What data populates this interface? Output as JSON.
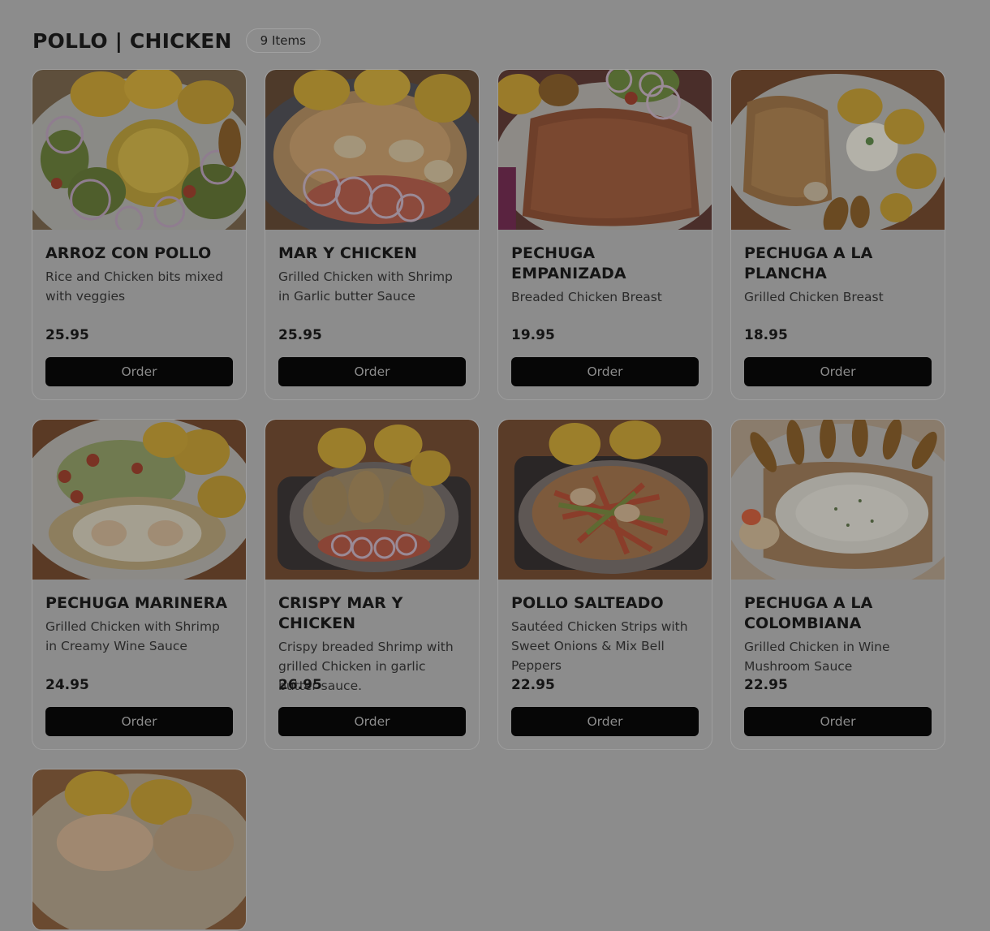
{
  "section": {
    "title": "POLLO | CHICKEN",
    "count": "9 Items"
  },
  "order_label": "Order",
  "items": [
    {
      "name": "ARROZ CON POLLO",
      "description": "Rice and Chicken bits mixed with veggies",
      "price": "25.95",
      "image": "rice-chicken-photo"
    },
    {
      "name": "MAR Y CHICKEN",
      "description": "Grilled Chicken with Shrimp in Garlic butter Sauce",
      "price": "25.95",
      "image": "chicken-shrimp-photo"
    },
    {
      "name": "PECHUGA EMPANIZADA",
      "description": "Breaded Chicken Breast",
      "price": "19.95",
      "image": "breaded-chicken-photo"
    },
    {
      "name": "PECHUGA A LA PLANCHA",
      "description": "Grilled Chicken Breast",
      "price": "18.95",
      "image": "grilled-chicken-photo"
    },
    {
      "name": "PECHUGA MARINERA",
      "description": "Grilled Chicken with Shrimp in Creamy Wine Sauce",
      "price": "24.95",
      "image": "marinera-photo"
    },
    {
      "name": "CRISPY MAR Y CHICKEN",
      "description": "Crispy breaded Shrimp with grilled Chicken in garlic butter sauce.",
      "price": "26.95",
      "image": "crispy-shrimp-chicken-photo"
    },
    {
      "name": "POLLO SALTEADO",
      "description": "Sautéed Chicken Strips with Sweet Onions & Mix Bell Peppers",
      "price": "22.95",
      "image": "sauteed-chicken-photo"
    },
    {
      "name": "PECHUGA A LA COLOMBIANA",
      "description": "Grilled Chicken in Wine Mushroom Sauce",
      "price": "22.95",
      "image": "colombiana-photo"
    }
  ],
  "partial_item": {
    "image": "ninth-dish-photo"
  }
}
